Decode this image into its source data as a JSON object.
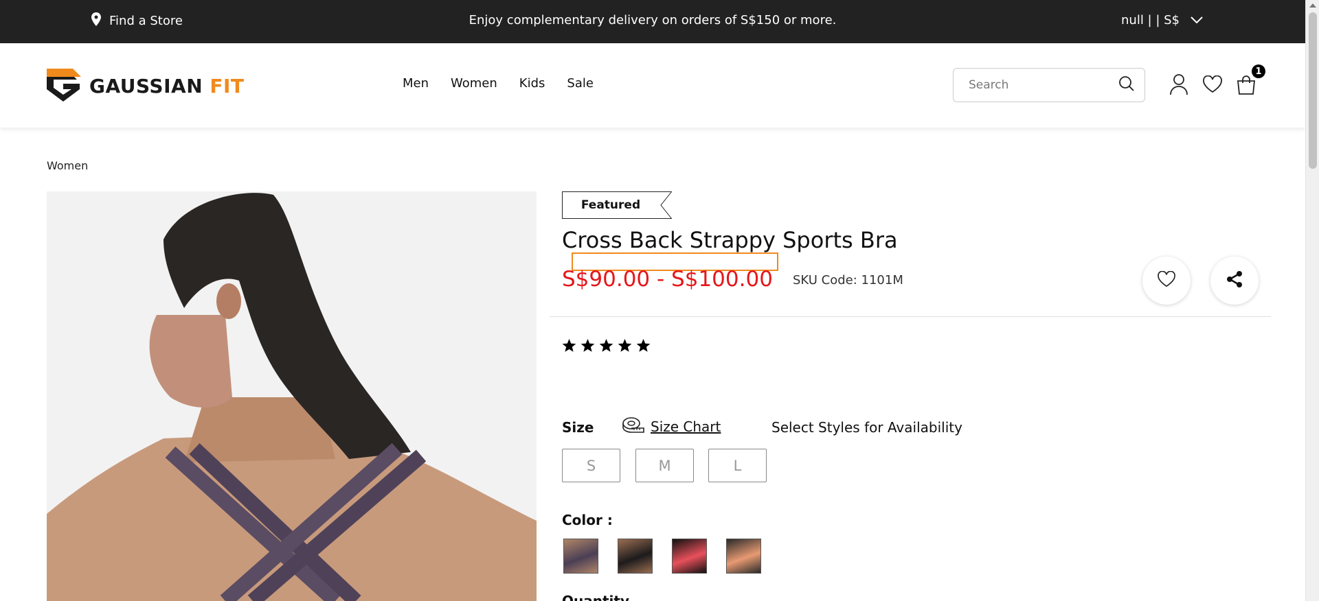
{
  "topbar": {
    "store_label": "Find a Store",
    "promo": "Enjoy complementary delivery on orders of S$150 or more.",
    "currency": "null | | S$"
  },
  "header": {
    "logo_dark": "GAUSSIAN",
    "logo_orange": "FIT",
    "nav": [
      "Men",
      "Women",
      "Kids",
      "Sale"
    ],
    "search_placeholder": "Search",
    "cart_count": "1"
  },
  "breadcrumb": "Women",
  "product": {
    "badge": "Featured",
    "title": "Cross Back Strappy Sports Bra",
    "price": "S$90.00 - S$100.00",
    "sku": "SKU Code: 1101M",
    "rating": 5,
    "size_label": "Size",
    "size_chart_label": "Size Chart",
    "availability": "Select Styles for Availability",
    "sizes": [
      "S",
      "M",
      "L"
    ],
    "color_label": "Color :",
    "colors": [
      {
        "name": "purple-swatch",
        "primary": "#4b3f55",
        "secondary": "#b08568"
      },
      {
        "name": "black-swatch",
        "primary": "#1d1b1c",
        "secondary": "#9a6e52"
      },
      {
        "name": "red-swatch",
        "primary": "#e8505b",
        "secondary": "#111111"
      },
      {
        "name": "peach-swatch",
        "primary": "#e89a72",
        "secondary": "#2a2a2a"
      }
    ],
    "quantity_label": "Quantity"
  },
  "colors": {
    "topbar": "#222222",
    "accent": "#f08a1d",
    "price": "#e5161b"
  }
}
